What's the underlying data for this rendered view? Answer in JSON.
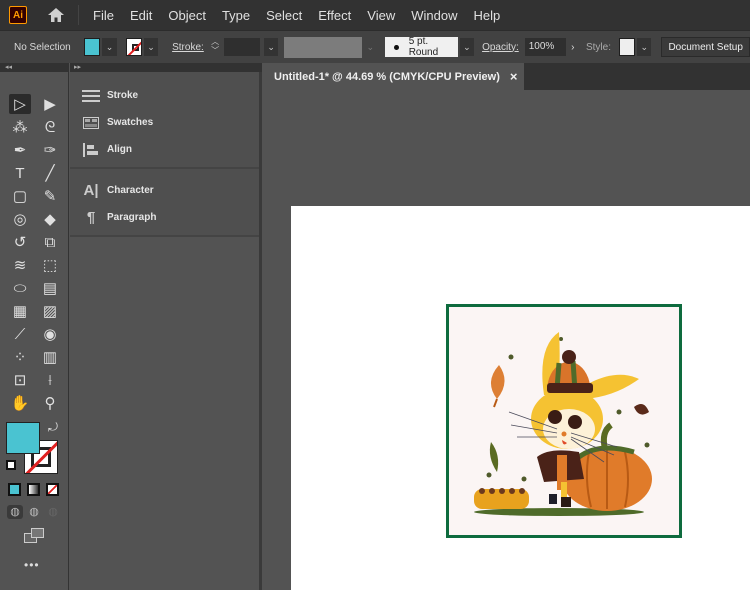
{
  "app": {
    "logo_label": "Ai",
    "home_icon": "home-icon"
  },
  "menu": [
    "File",
    "Edit",
    "Object",
    "Type",
    "Select",
    "Effect",
    "View",
    "Window",
    "Help"
  ],
  "control_bar": {
    "selection_label": "No Selection",
    "fill_color": "#4ac3d1",
    "stroke_label": "Stroke:",
    "stroke_weight": "",
    "brush_label": "5 pt. Round",
    "opacity_label": "Opacity:",
    "opacity_value": "100%",
    "style_label": "Style:",
    "document_button": "Document Setup"
  },
  "document_tab": {
    "title": "Untitled-1* @ 44.69 % (CMYK/CPU Preview)",
    "close_icon": "×"
  },
  "panels": {
    "group1": [
      {
        "label": "Stroke",
        "icon": "stroke-icon"
      },
      {
        "label": "Swatches",
        "icon": "swatches-icon"
      },
      {
        "label": "Align",
        "icon": "align-icon"
      }
    ],
    "group2": [
      {
        "label": "Character",
        "icon": "character-icon"
      },
      {
        "label": "Paragraph",
        "icon": "paragraph-icon"
      }
    ]
  },
  "toolbar": {
    "tools": [
      {
        "name": "selection-tool",
        "glyph": "▷"
      },
      {
        "name": "direct-selection-tool",
        "glyph": "▶"
      },
      {
        "name": "magic-wand-tool",
        "glyph": "⁂"
      },
      {
        "name": "lasso-tool",
        "glyph": "ᘓ"
      },
      {
        "name": "pen-tool",
        "glyph": "✒"
      },
      {
        "name": "curvature-tool",
        "glyph": "✑"
      },
      {
        "name": "type-tool",
        "glyph": "T"
      },
      {
        "name": "line-segment-tool",
        "glyph": "╱"
      },
      {
        "name": "rectangle-tool",
        "glyph": "▢"
      },
      {
        "name": "paintbrush-tool",
        "glyph": "✎"
      },
      {
        "name": "shaper-tool",
        "glyph": "◎"
      },
      {
        "name": "eraser-tool",
        "glyph": "◆"
      },
      {
        "name": "rotate-tool",
        "glyph": "↺"
      },
      {
        "name": "scale-tool",
        "glyph": "⧉"
      },
      {
        "name": "warp-tool",
        "glyph": "≋"
      },
      {
        "name": "free-transform-tool",
        "glyph": "⬚"
      },
      {
        "name": "shape-builder-tool",
        "glyph": "⬭"
      },
      {
        "name": "perspective-grid-tool",
        "glyph": "▤"
      },
      {
        "name": "mesh-tool",
        "glyph": "▦"
      },
      {
        "name": "gradient-tool",
        "glyph": "▨"
      },
      {
        "name": "eyedropper-tool",
        "glyph": "⟋"
      },
      {
        "name": "blend-tool",
        "glyph": "◉"
      },
      {
        "name": "symbol-sprayer-tool",
        "glyph": "⁘"
      },
      {
        "name": "column-graph-tool",
        "glyph": "▥"
      },
      {
        "name": "artboard-tool",
        "glyph": "⊡"
      },
      {
        "name": "slice-tool",
        "glyph": "⟊"
      },
      {
        "name": "hand-tool",
        "glyph": "✋"
      },
      {
        "name": "zoom-tool",
        "glyph": "⚲"
      }
    ],
    "fill_color": "#4ac3d1",
    "more_label": "•••"
  },
  "artwork": {
    "frame_color": "#0e6b3e",
    "background_color": "#fbf5f4"
  }
}
